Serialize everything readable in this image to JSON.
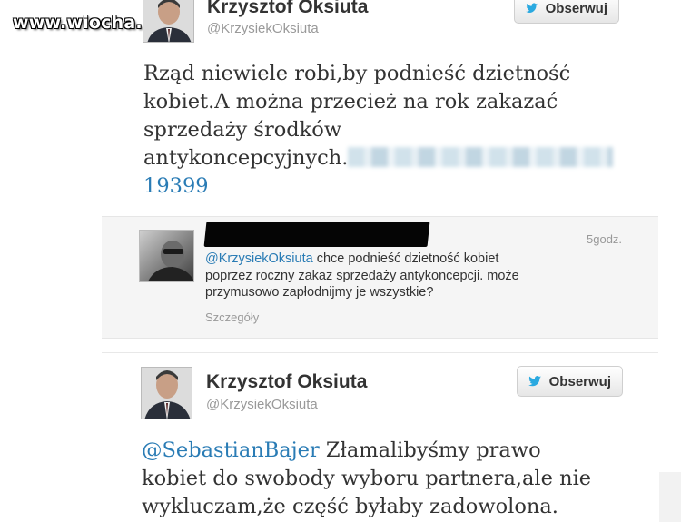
{
  "watermark": "www.wiocha.pl",
  "tweet1": {
    "author_name": "Krzysztof Oksiuta",
    "author_handle": "@KrzysiekOksiuta",
    "follow_label": "Obserwuj",
    "text_lines": [
      "Rząd niewiele robi,by podnieść dzietność",
      "kobiet.A można przecież na rok zakazać",
      "sprzedaży środków",
      "antykoncepcyjnych."
    ],
    "link_tail": "19399"
  },
  "reply": {
    "time": "5godz.",
    "mention": "@KrzysiekOksiuta",
    "text_lines": [
      " chce podnieść dzietność kobiet",
      "poprzez roczny zakaz sprzedaży antykoncepcji. może",
      "przymusowo zapłodnijmy je wszystkie?"
    ],
    "details_label": "Szczegóły"
  },
  "tweet2": {
    "author_name": "Krzysztof Oksiuta",
    "author_handle": "@KrzysiekOksiuta",
    "follow_label": "Obserwuj",
    "mention": "@SebastianBajer",
    "text_lines": [
      " Złamalibyśmy prawo",
      "kobiet do swobody wyboru partnera,ale nie",
      "wykluczam,że część byłaby zadowolona."
    ]
  },
  "colors": {
    "link_blue": "#2a7cb5",
    "twitter_bird": "#2aa9e0",
    "handle_gray": "#999999",
    "panel_bg": "#f5f5f5"
  },
  "icons": [
    "twitter-bird-icon"
  ]
}
